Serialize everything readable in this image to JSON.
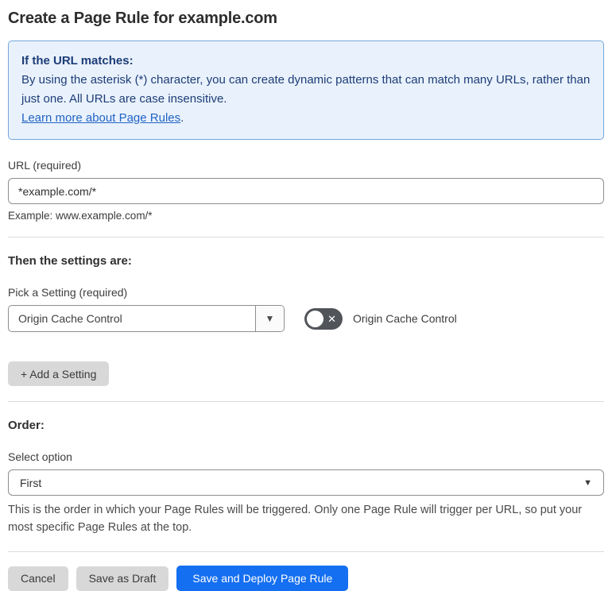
{
  "page": {
    "title": "Create a Page Rule for example.com"
  },
  "info_box": {
    "heading": "If the URL matches:",
    "body": "By using the asterisk (*) character, you can create dynamic patterns that can match many URLs, rather than just one. All URLs are case insensitive.",
    "link_label": "Learn more about Page Rules",
    "link_suffix": "."
  },
  "url_field": {
    "label": "URL (required)",
    "value": "*example.com/*",
    "example": "Example: www.example.com/*"
  },
  "settings_section": {
    "heading": "Then the settings are:",
    "picker_label": "Pick a Setting (required)",
    "picker_value": "Origin Cache Control",
    "toggle": {
      "state": "off",
      "icon": "✕",
      "label": "Origin Cache Control"
    },
    "add_setting_label": "+ Add a Setting",
    "dropdown_caret": "▼"
  },
  "order_section": {
    "heading": "Order:",
    "select_label": "Select option",
    "select_value": "First",
    "caret": "▼",
    "help_text": "This is the order in which your Page Rules will be triggered. Only one Page Rule will trigger per URL, so put your most specific Page Rules at the top."
  },
  "footer": {
    "cancel_label": "Cancel",
    "save_draft_label": "Save as Draft",
    "save_deploy_label": "Save and Deploy Page Rule"
  },
  "colors": {
    "accent_blue": "#156ff1",
    "info_background": "#e9f2fc",
    "info_border": "#74a7dd",
    "info_text": "#1d3c78",
    "link_blue": "#2263c5",
    "toggle_off_background": "#515459",
    "gray_button_background": "#d8d8d8"
  }
}
